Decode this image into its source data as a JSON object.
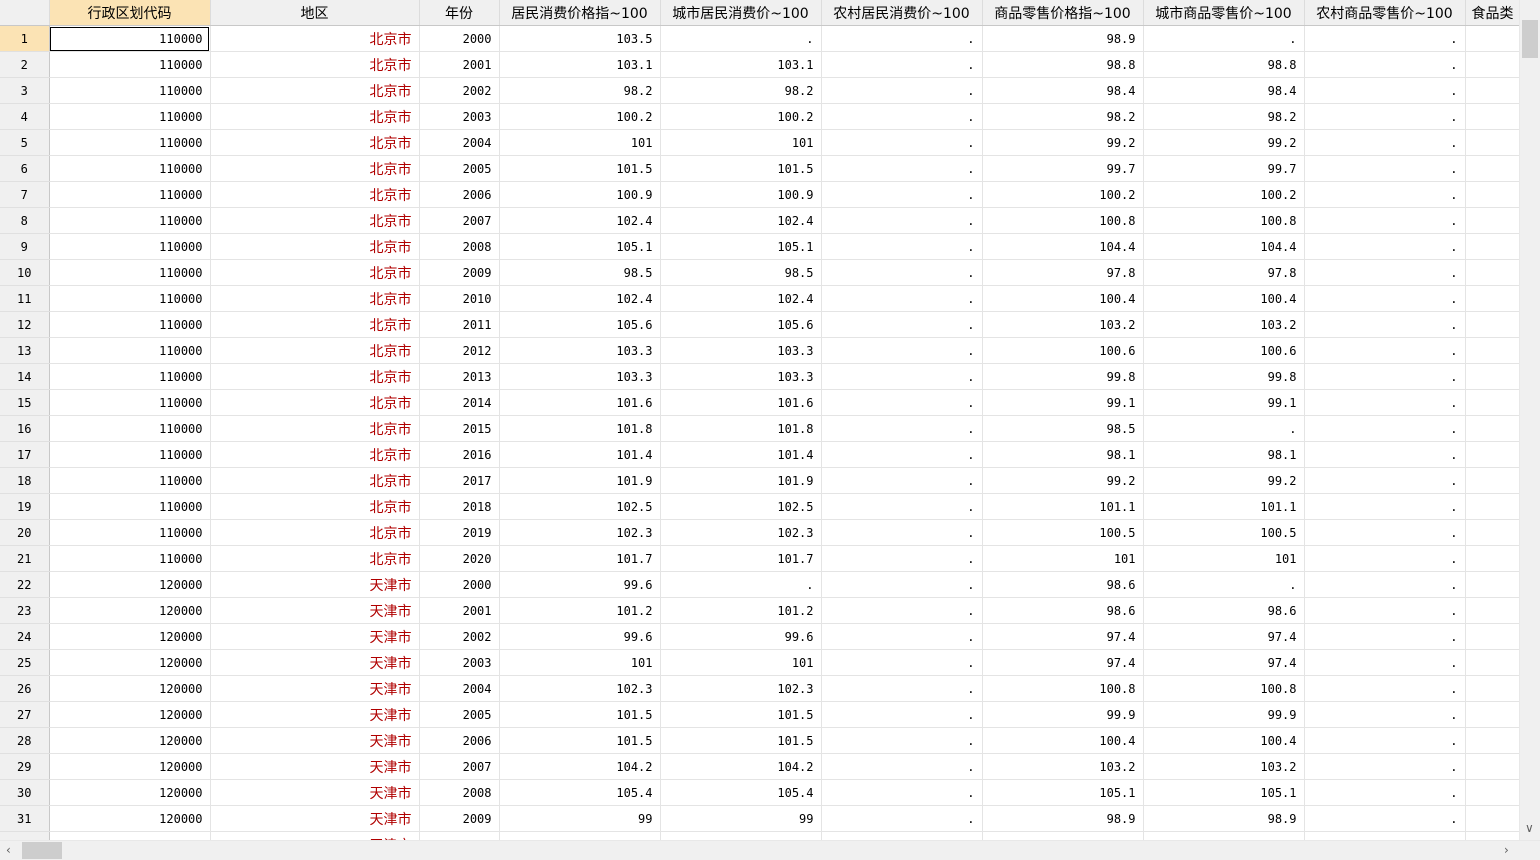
{
  "columns": [
    "行政区划代码",
    "地区",
    "年份",
    "居民消费价格指~100",
    "城市居民消费价~100",
    "农村居民消费价~100",
    "商品零售价格指~100",
    "城市商品零售价~100",
    "农村商品零售价~100",
    "食品类"
  ],
  "rows": [
    [
      "1",
      "110000",
      "北京市",
      "2000",
      "103.5",
      ".",
      ".",
      "98.9",
      ".",
      "."
    ],
    [
      "2",
      "110000",
      "北京市",
      "2001",
      "103.1",
      "103.1",
      ".",
      "98.8",
      "98.8",
      "."
    ],
    [
      "3",
      "110000",
      "北京市",
      "2002",
      "98.2",
      "98.2",
      ".",
      "98.4",
      "98.4",
      "."
    ],
    [
      "4",
      "110000",
      "北京市",
      "2003",
      "100.2",
      "100.2",
      ".",
      "98.2",
      "98.2",
      "."
    ],
    [
      "5",
      "110000",
      "北京市",
      "2004",
      "101",
      "101",
      ".",
      "99.2",
      "99.2",
      "."
    ],
    [
      "6",
      "110000",
      "北京市",
      "2005",
      "101.5",
      "101.5",
      ".",
      "99.7",
      "99.7",
      "."
    ],
    [
      "7",
      "110000",
      "北京市",
      "2006",
      "100.9",
      "100.9",
      ".",
      "100.2",
      "100.2",
      "."
    ],
    [
      "8",
      "110000",
      "北京市",
      "2007",
      "102.4",
      "102.4",
      ".",
      "100.8",
      "100.8",
      "."
    ],
    [
      "9",
      "110000",
      "北京市",
      "2008",
      "105.1",
      "105.1",
      ".",
      "104.4",
      "104.4",
      "."
    ],
    [
      "10",
      "110000",
      "北京市",
      "2009",
      "98.5",
      "98.5",
      ".",
      "97.8",
      "97.8",
      "."
    ],
    [
      "11",
      "110000",
      "北京市",
      "2010",
      "102.4",
      "102.4",
      ".",
      "100.4",
      "100.4",
      "."
    ],
    [
      "12",
      "110000",
      "北京市",
      "2011",
      "105.6",
      "105.6",
      ".",
      "103.2",
      "103.2",
      "."
    ],
    [
      "13",
      "110000",
      "北京市",
      "2012",
      "103.3",
      "103.3",
      ".",
      "100.6",
      "100.6",
      "."
    ],
    [
      "14",
      "110000",
      "北京市",
      "2013",
      "103.3",
      "103.3",
      ".",
      "99.8",
      "99.8",
      "."
    ],
    [
      "15",
      "110000",
      "北京市",
      "2014",
      "101.6",
      "101.6",
      ".",
      "99.1",
      "99.1",
      "."
    ],
    [
      "16",
      "110000",
      "北京市",
      "2015",
      "101.8",
      "101.8",
      ".",
      "98.5",
      ".",
      "."
    ],
    [
      "17",
      "110000",
      "北京市",
      "2016",
      "101.4",
      "101.4",
      ".",
      "98.1",
      "98.1",
      "."
    ],
    [
      "18",
      "110000",
      "北京市",
      "2017",
      "101.9",
      "101.9",
      ".",
      "99.2",
      "99.2",
      "."
    ],
    [
      "19",
      "110000",
      "北京市",
      "2018",
      "102.5",
      "102.5",
      ".",
      "101.1",
      "101.1",
      "."
    ],
    [
      "20",
      "110000",
      "北京市",
      "2019",
      "102.3",
      "102.3",
      ".",
      "100.5",
      "100.5",
      "."
    ],
    [
      "21",
      "110000",
      "北京市",
      "2020",
      "101.7",
      "101.7",
      ".",
      "101",
      "101",
      "."
    ],
    [
      "22",
      "120000",
      "天津市",
      "2000",
      "99.6",
      ".",
      ".",
      "98.6",
      ".",
      "."
    ],
    [
      "23",
      "120000",
      "天津市",
      "2001",
      "101.2",
      "101.2",
      ".",
      "98.6",
      "98.6",
      "."
    ],
    [
      "24",
      "120000",
      "天津市",
      "2002",
      "99.6",
      "99.6",
      ".",
      "97.4",
      "97.4",
      "."
    ],
    [
      "25",
      "120000",
      "天津市",
      "2003",
      "101",
      "101",
      ".",
      "97.4",
      "97.4",
      "."
    ],
    [
      "26",
      "120000",
      "天津市",
      "2004",
      "102.3",
      "102.3",
      ".",
      "100.8",
      "100.8",
      "."
    ],
    [
      "27",
      "120000",
      "天津市",
      "2005",
      "101.5",
      "101.5",
      ".",
      "99.9",
      "99.9",
      "."
    ],
    [
      "28",
      "120000",
      "天津市",
      "2006",
      "101.5",
      "101.5",
      ".",
      "100.4",
      "100.4",
      "."
    ],
    [
      "29",
      "120000",
      "天津市",
      "2007",
      "104.2",
      "104.2",
      ".",
      "103.2",
      "103.2",
      "."
    ],
    [
      "30",
      "120000",
      "天津市",
      "2008",
      "105.4",
      "105.4",
      ".",
      "105.1",
      "105.1",
      "."
    ],
    [
      "31",
      "120000",
      "天津市",
      "2009",
      "99",
      "99",
      ".",
      "98.9",
      "98.9",
      "."
    ]
  ],
  "partial_row_region": "天津市",
  "colors": {
    "header_bg": "#f0f0f0",
    "selected_header_bg": "#fbe3b4",
    "region_text": "#b00000"
  },
  "icons": {
    "scroll_down": "chevron-down-icon",
    "scroll_left": "chevron-left-icon",
    "scroll_right": "chevron-right-icon"
  }
}
